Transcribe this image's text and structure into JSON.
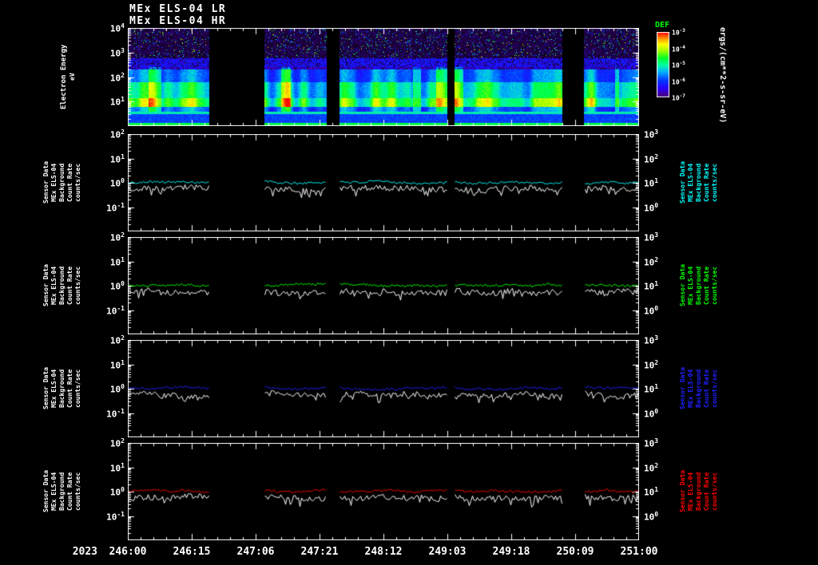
{
  "header": {
    "title_lr": "MEx ELS-04 LR",
    "title_hr": "MEx ELS-04 HR"
  },
  "time_axis": {
    "year": "2023",
    "tick_labels": [
      "246:00",
      "246:15",
      "247:06",
      "247:21",
      "248:12",
      "249:03",
      "249:18",
      "250:09",
      "251:00"
    ],
    "segments": [
      [
        0.0,
        0.159
      ],
      [
        0.266,
        0.388
      ],
      [
        0.413,
        0.625
      ],
      [
        0.638,
        0.85
      ],
      [
        0.892,
        1.0
      ]
    ]
  },
  "chart_data": [
    {
      "type": "heatmap",
      "name": "electron-energy-spectrogram",
      "ylabel": "Electron Energy",
      "y_unit": "eV",
      "ylim_log10": [
        0,
        4
      ],
      "y_tick_exponents": [
        4,
        3,
        2,
        1
      ],
      "value_label": "DEF",
      "value_label_color": "#00ff00",
      "value_unit": "ergs/(cm**2-s-sr-eV)",
      "colorbar_tick_exponents": [
        -3,
        -4,
        -5,
        -6,
        -7
      ],
      "seed": 42,
      "bands": [
        {
          "log_e": [
            0.0,
            0.12
          ],
          "level": 0.6
        },
        {
          "log_e": [
            0.12,
            0.5
          ],
          "level": 0.3
        },
        {
          "log_e": [
            0.5,
            0.78
          ],
          "level": 0.5
        },
        {
          "log_e": [
            0.78,
            1.15
          ],
          "level": 0.88
        },
        {
          "log_e": [
            1.15,
            1.8
          ],
          "level": 0.7
        },
        {
          "log_e": [
            1.8,
            2.3
          ],
          "level": 0.48
        },
        {
          "log_e": [
            2.3,
            2.75
          ],
          "level": 0.22,
          "holes": 0.25
        },
        {
          "log_e": [
            2.75,
            4.01
          ],
          "level": 0.03,
          "speckle": 0.1
        }
      ]
    },
    {
      "type": "line",
      "name": "sensor-count-rate-panel-1",
      "axis_label_lines": [
        "Sensor Data",
        "MEx ELS-04",
        "Background",
        "Count Rate",
        "counts/sec"
      ],
      "right_label_color": "#00ffff",
      "ylim_log10": [
        -2,
        2
      ],
      "left_tick_exponents": [
        2,
        1,
        0,
        -1
      ],
      "right_tick_exponents": [
        3,
        2,
        1,
        0
      ],
      "series": [
        {
          "name": "background count rate",
          "color": "#00ffff",
          "mean": 1.05,
          "wander": 0.05,
          "jitter": 0.05,
          "dip_prob": 0.0,
          "dip_depth": 0.0,
          "seed": 101
        },
        {
          "name": "count rate",
          "color": "#ffffff",
          "mean": 0.55,
          "wander": 0.07,
          "jitter": 0.12,
          "dip_prob": 0.15,
          "dip_depth": 0.3,
          "seed": 102
        }
      ]
    },
    {
      "type": "line",
      "name": "sensor-count-rate-panel-2",
      "axis_label_lines": [
        "Sensor Data",
        "MEx ELS-04",
        "Background",
        "Count Rate",
        "counts/sec"
      ],
      "right_label_color": "#00ff00",
      "ylim_log10": [
        -2,
        2
      ],
      "left_tick_exponents": [
        2,
        1,
        0,
        -1
      ],
      "right_tick_exponents": [
        3,
        2,
        1,
        0
      ],
      "series": [
        {
          "name": "background count rate",
          "color": "#00ff00",
          "mean": 1.05,
          "wander": 0.05,
          "jitter": 0.05,
          "dip_prob": 0.0,
          "dip_depth": 0.0,
          "seed": 201
        },
        {
          "name": "count rate",
          "color": "#ffffff",
          "mean": 0.55,
          "wander": 0.07,
          "jitter": 0.12,
          "dip_prob": 0.15,
          "dip_depth": 0.3,
          "seed": 202
        }
      ]
    },
    {
      "type": "line",
      "name": "sensor-count-rate-panel-3",
      "axis_label_lines": [
        "Sensor Data",
        "MEx ELS-04",
        "Background",
        "Count Rate",
        "counts/sec"
      ],
      "right_label_color": "#2020ff",
      "ylim_log10": [
        -2,
        2
      ],
      "left_tick_exponents": [
        2,
        1,
        0,
        -1
      ],
      "right_tick_exponents": [
        3,
        2,
        1,
        0
      ],
      "series": [
        {
          "name": "background count rate",
          "color": "#2020ff",
          "mean": 1.05,
          "wander": 0.05,
          "jitter": 0.05,
          "dip_prob": 0.0,
          "dip_depth": 0.0,
          "seed": 301
        },
        {
          "name": "count rate",
          "color": "#ffffff",
          "mean": 0.55,
          "wander": 0.07,
          "jitter": 0.12,
          "dip_prob": 0.15,
          "dip_depth": 0.3,
          "seed": 302
        }
      ]
    },
    {
      "type": "line",
      "name": "sensor-count-rate-panel-4",
      "axis_label_lines": [
        "Sensor Data",
        "MEx ELS-04",
        "Background",
        "Count Rate",
        "counts/sec"
      ],
      "right_label_color": "#ff0000",
      "ylim_log10": [
        -2,
        2
      ],
      "left_tick_exponents": [
        2,
        1,
        0,
        -1
      ],
      "right_tick_exponents": [
        3,
        2,
        1,
        0
      ],
      "series": [
        {
          "name": "background count rate",
          "color": "#ff0000",
          "mean": 1.05,
          "wander": 0.05,
          "jitter": 0.05,
          "dip_prob": 0.0,
          "dip_depth": 0.0,
          "seed": 401
        },
        {
          "name": "count rate",
          "color": "#ffffff",
          "mean": 0.55,
          "wander": 0.07,
          "jitter": 0.12,
          "dip_prob": 0.15,
          "dip_depth": 0.3,
          "seed": 402
        }
      ]
    }
  ]
}
